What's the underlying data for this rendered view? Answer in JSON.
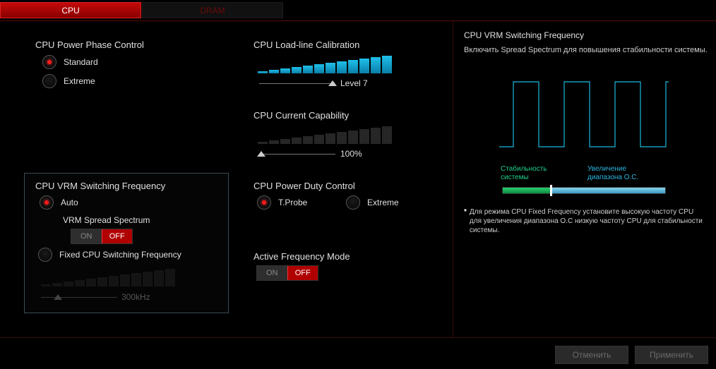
{
  "tabs": [
    {
      "label": "CPU",
      "active": true
    },
    {
      "label": "DRAM",
      "active": false
    }
  ],
  "phase": {
    "title": "CPU Power Phase Control",
    "options": [
      "Standard",
      "Extreme"
    ],
    "selected": "Standard"
  },
  "llc": {
    "title": "CPU Load-line Calibration",
    "value": "Level 7",
    "level": 1.0
  },
  "current": {
    "title": "CPU Current Capability",
    "value": "100%",
    "level": 0.0
  },
  "vrm": {
    "title": "CPU VRM Switching Frequency",
    "auto_label": "Auto",
    "spread_label": "VRM Spread Spectrum",
    "toggle_on": "ON",
    "toggle_off": "OFF",
    "fixed_label": "Fixed CPU Switching Frequency",
    "freq_value": "300kHz",
    "selected": "Auto"
  },
  "duty": {
    "title": "CPU Power Duty Control",
    "options": [
      "T.Probe",
      "Extreme"
    ],
    "selected": "T.Probe"
  },
  "afm": {
    "title": "Active Frequency Mode",
    "toggle_on": "ON",
    "toggle_off": "OFF"
  },
  "help": {
    "title": "CPU VRM Switching Frequency",
    "subtitle": "Включить Spread Spectrum для повышения стабильности системы.",
    "stability_label": "Стабильность системы",
    "increase_label": "Увеличение диапазона О.С.",
    "note_star": "*",
    "note": "Для режима CPU Fixed Frequency установите высокую частоту CPU для увеличения диапазона О.С низкую частоту CPU для стабильности системы."
  },
  "footer": {
    "cancel": "Отменить",
    "apply": "Применить"
  },
  "colors": {
    "accent": "#b00000",
    "cyan": "#1ab8e0",
    "green": "#1fd08a"
  }
}
